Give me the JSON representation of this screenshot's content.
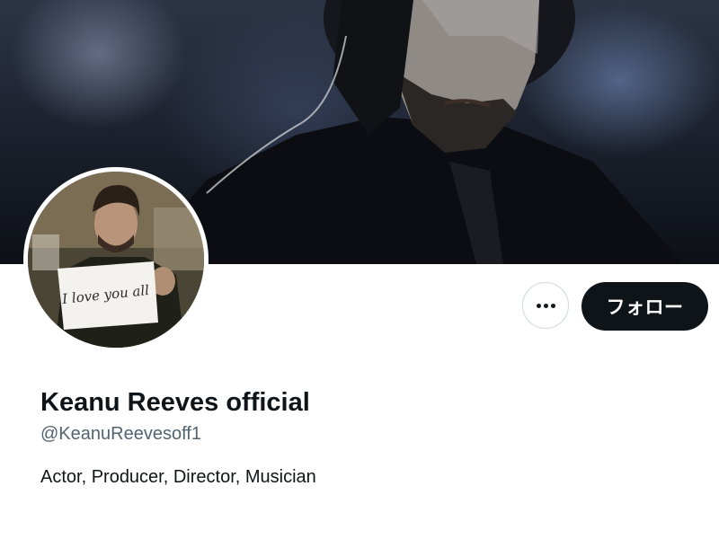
{
  "profile": {
    "display_name": "Keanu Reeves official",
    "handle": "@KeanuReevesoff1",
    "bio": "Actor, Producer, Director, Musician"
  },
  "avatar": {
    "sign_text": "I love you all"
  },
  "actions": {
    "more_icon": "more-horizontal-icon",
    "follow_label": "フォロー"
  },
  "colors": {
    "follow_bg": "#0f1419",
    "follow_text": "#ffffff",
    "handle_text": "#536471",
    "primary_text": "#0f1419",
    "border": "#cfd9de"
  }
}
